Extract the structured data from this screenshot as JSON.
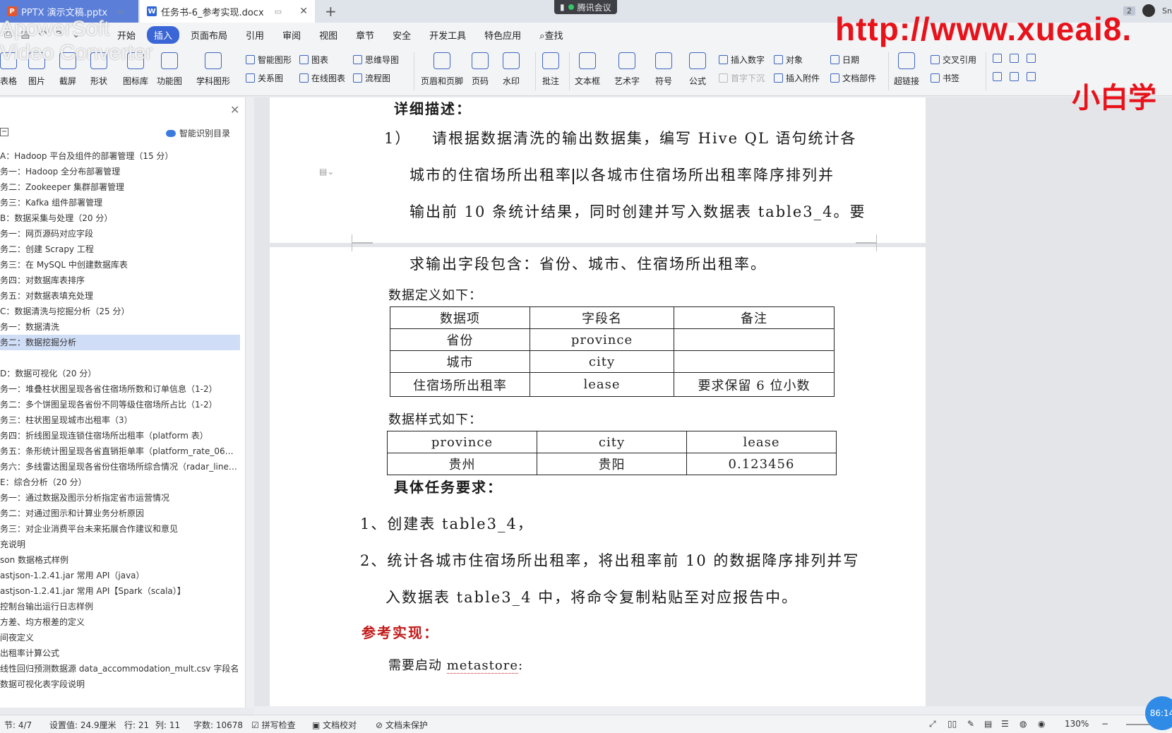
{
  "tabs": [
    {
      "label": "PPTX 演示文稿.pptx",
      "icon": "P"
    },
    {
      "label": "任务书-6_参考实现.docx",
      "icon": "W"
    }
  ],
  "meeting": "腾讯会议",
  "top_right": {
    "badge": "2",
    "user": "Sn"
  },
  "watermark": {
    "url": "http://www.xueai8.",
    "brand": "小白学",
    "converter": "ApowerSoft\nVideo Converter"
  },
  "menu": [
    "开始",
    "插入",
    "页面布局",
    "引用",
    "审阅",
    "视图",
    "章节",
    "安全",
    "开发工具",
    "特色应用",
    "查找"
  ],
  "ribbon": {
    "big": [
      "表格",
      "图片",
      "截屏",
      "形状",
      "图标库",
      "功能图",
      "学科图形",
      "页眉和页脚",
      "页码",
      "水印",
      "批注",
      "文本框",
      "艺术字",
      "符号",
      "公式",
      "超链接"
    ],
    "small": [
      "智能图形",
      "图表",
      "思维导图",
      "关系图",
      "在线图表",
      "流程图",
      "插入数字",
      "对象",
      "日期",
      "首字下沉",
      "插入附件",
      "文档部件",
      "交叉引用",
      "书签"
    ]
  },
  "nav": {
    "smart_label": "智能识别目录",
    "items": [
      "A：Hadoop 平台及组件的部署管理（15 分）",
      "务一：Hadoop 全分布部署管理",
      "务二：Zookeeper 集群部署管理",
      "务三：Kafka 组件部署管理",
      "B：数据采集与处理（20 分）",
      "务一：网页源码对应字段",
      "务二：创建 Scrapy 工程",
      "务三：在 MySQL 中创建数据库表",
      "务四：对数据库表排序",
      "务五：对数据表填充处理",
      "C：数据清洗与挖掘分析（25 分）",
      "务一：数据清洗",
      "务二：数据挖掘分析",
      "",
      "D：数据可视化（20 分）",
      "务一：堆叠柱状图呈现各省住宿场所数和订单信息（1-2）",
      "务二：多个饼图呈现各省份不同等级住宿场所占比（1-2）",
      "务三：柱状图呈现城市出租率（3）",
      "务四：折线图呈现连锁住宿场所出租率（platform 表）",
      "务五：条形统计图呈现各省直销拒单率（platform_rate_06…",
      "务六：多线雷达图呈现各省份住宿场所综合情况（radar_line…",
      "E：综合分析（20 分）",
      "务一：通过数据及图示分析指定省市运营情况",
      "务二：对通过图示和计算业务分析原因",
      "务三：对企业消费平台未来拓展合作建议和意见",
      "充说明",
      "son 数据格式样例",
      "astjson-1.2.41.jar 常用 API（java）",
      "astjson-1.2.41.jar 常用 API【Spark（scala）】",
      "控制台输出运行日志样例",
      "方差、均方根差的定义",
      "间夜定义",
      "出租率计算公式",
      "线性回归预测数据源 data_accommodation_mult.csv 字段名",
      "数据可视化表字段说明"
    ],
    "selected_index": 12
  },
  "doc": {
    "heading_desc": "详细描述：",
    "item1_num": "1）",
    "line1": "请根据数据清洗的输出数据集，编写 Hive QL 语句统计各",
    "line2a": "城市的住宿场所出租率",
    "line2b": "以各城市住宿场所出租率降序排列并",
    "line3": "输出前 10 条统计结果，同时创建并写入数据表 table3_4。要",
    "line4": "求输出字段包含：省份、城市、住宿场所出租率。",
    "data_def_label": "数据定义如下：",
    "def_table": [
      [
        "数据项",
        "字段名",
        "备注"
      ],
      [
        "省份",
        "province",
        ""
      ],
      [
        "城市",
        "city",
        ""
      ],
      [
        "住宿场所出租率",
        "lease",
        "要求保留 6 位小数"
      ]
    ],
    "data_sample_label": "数据样式如下：",
    "sample_table": [
      [
        "province",
        "city",
        "lease"
      ],
      [
        "贵州",
        "贵阳",
        "0.123456"
      ]
    ],
    "heading_req": "具体任务要求：",
    "req1": "1、创建表 table3_4，",
    "req2a": "2、统计各城市住宿场所出租率，将出租率前 10 的数据降序排列并写",
    "req2b": "入数据表 table3_4 中，将命令复制粘贴至对应报告中。",
    "ref_heading": "参考实现：",
    "metastore_a": "需要启动 ",
    "metastore_b": "metastore",
    "metastore_c": ":"
  },
  "status": {
    "section": "节: 4/7",
    "setting": "设置值: 24.9厘米",
    "row": "行: 21",
    "col": "列: 11",
    "words": "字数: 10678",
    "spell": "拼写检查",
    "proof": "文档校对",
    "protect": "文档未保护",
    "zoom": "130%",
    "timer": "86:14"
  }
}
